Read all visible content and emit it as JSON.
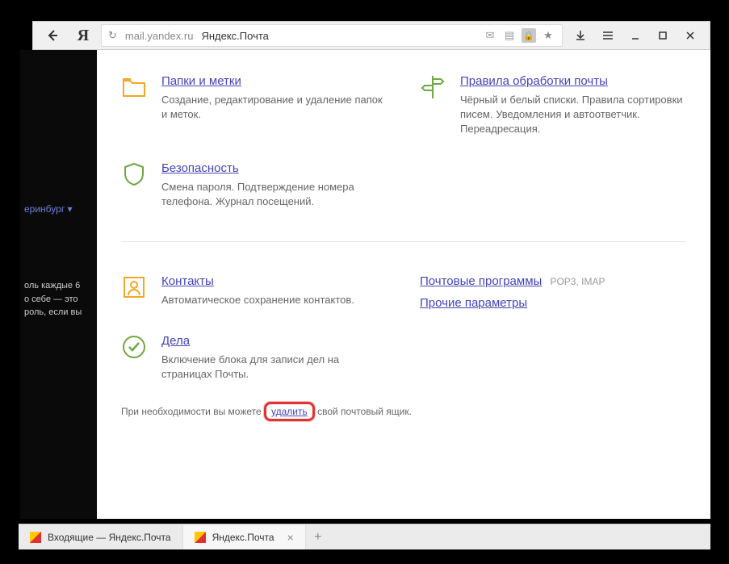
{
  "chrome": {
    "url": "mail.yandex.ru",
    "title": "Яндекс.Почта"
  },
  "bg": {
    "city": "еринбург ▾",
    "snippet1": "оль каждые 6",
    "snippet2": "о себе — это",
    "snippet3": "роль, если вы"
  },
  "settings": {
    "folders": {
      "title": "Папки и метки",
      "desc": "Создание, редактирование и удаление папок и меток."
    },
    "rules": {
      "title": "Правила обработки почты",
      "desc": "Чёрный и белый списки. Правила сортировки писем. Уведомления и автоответчик. Переадресация."
    },
    "security": {
      "title": "Безопасность",
      "desc": "Смена пароля. Подтверждение номера телефона. Журнал посещений."
    },
    "contacts": {
      "title": "Контакты",
      "desc": "Автоматическое сохранение контактов."
    },
    "todo": {
      "title": "Дела",
      "desc": "Включение блока для записи дел на страницах Почты."
    },
    "rightLinks": {
      "mailClients": "Почтовые программы",
      "protocols": "POP3, IMAP",
      "other": "Прочие параметры"
    }
  },
  "deleteNote": {
    "before": "При необходимости вы можете ",
    "link": "удалить",
    "after": " свой почтовый ящик."
  },
  "tabs": {
    "tab1": "Входящие — Яндекс.Почта",
    "tab2": "Яндекс.Почта"
  }
}
